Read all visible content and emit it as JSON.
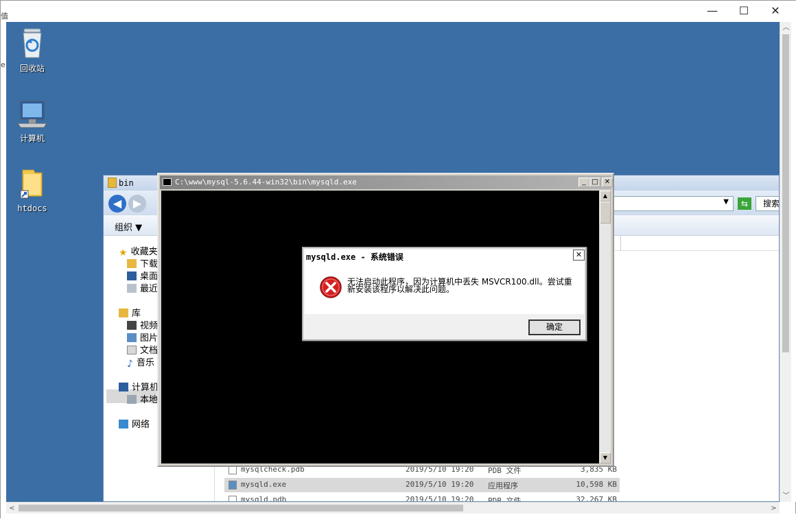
{
  "outer_window": {
    "controls": {
      "minimize": "—",
      "maximize": "☐",
      "close": "✕"
    },
    "left_glyph_a": "值",
    "left_glyph_b": "e"
  },
  "desktop": {
    "icons": [
      {
        "label": "回收站",
        "icon": "recycle-bin-icon"
      },
      {
        "label": "计算机",
        "icon": "computer-icon"
      },
      {
        "label": "htdocs",
        "icon": "folder-shortcut-icon"
      }
    ]
  },
  "explorer": {
    "title": "bin",
    "toolbar": {
      "organize": "组织 ▼"
    },
    "search_placeholder": "搜索",
    "sidebar": {
      "favorites": "收藏夹",
      "downloads": "下载",
      "desktop": "桌面",
      "recent": "最近",
      "libraries": "库",
      "videos": "视频",
      "pictures": "图片",
      "documents": "文档",
      "music": "音乐",
      "computer": "计算机",
      "local_disk": "本地",
      "network": "网络"
    },
    "files": [
      {
        "name": "mysqlcheck.pdb",
        "date": "2019/5/10 19:20",
        "type": "PDB 文件",
        "size": "3,835 KB",
        "selected": false
      },
      {
        "name": "mysqld.exe",
        "date": "2019/5/10 19:20",
        "type": "应用程序",
        "size": "10,598 KB",
        "selected": true
      },
      {
        "name": "mysqld.pdb",
        "date": "2019/5/10 19:20",
        "type": "PDB 文件",
        "size": "32,267 KB",
        "selected": false
      }
    ]
  },
  "console": {
    "title": "C:\\www\\mysql-5.6.44-win32\\bin\\mysqld.exe",
    "controls": {
      "minimize": "_",
      "maximize": "□",
      "close": "✕"
    }
  },
  "dialog": {
    "title": "mysqld.exe - 系统错误",
    "message": "无法启动此程序，因为计算机中丢失 MSVCR100.dll。尝试重新安装该程序以解决此问题。",
    "ok_label": "确定",
    "close_label": "✕",
    "colors": {
      "error_red": "#d42020"
    }
  }
}
